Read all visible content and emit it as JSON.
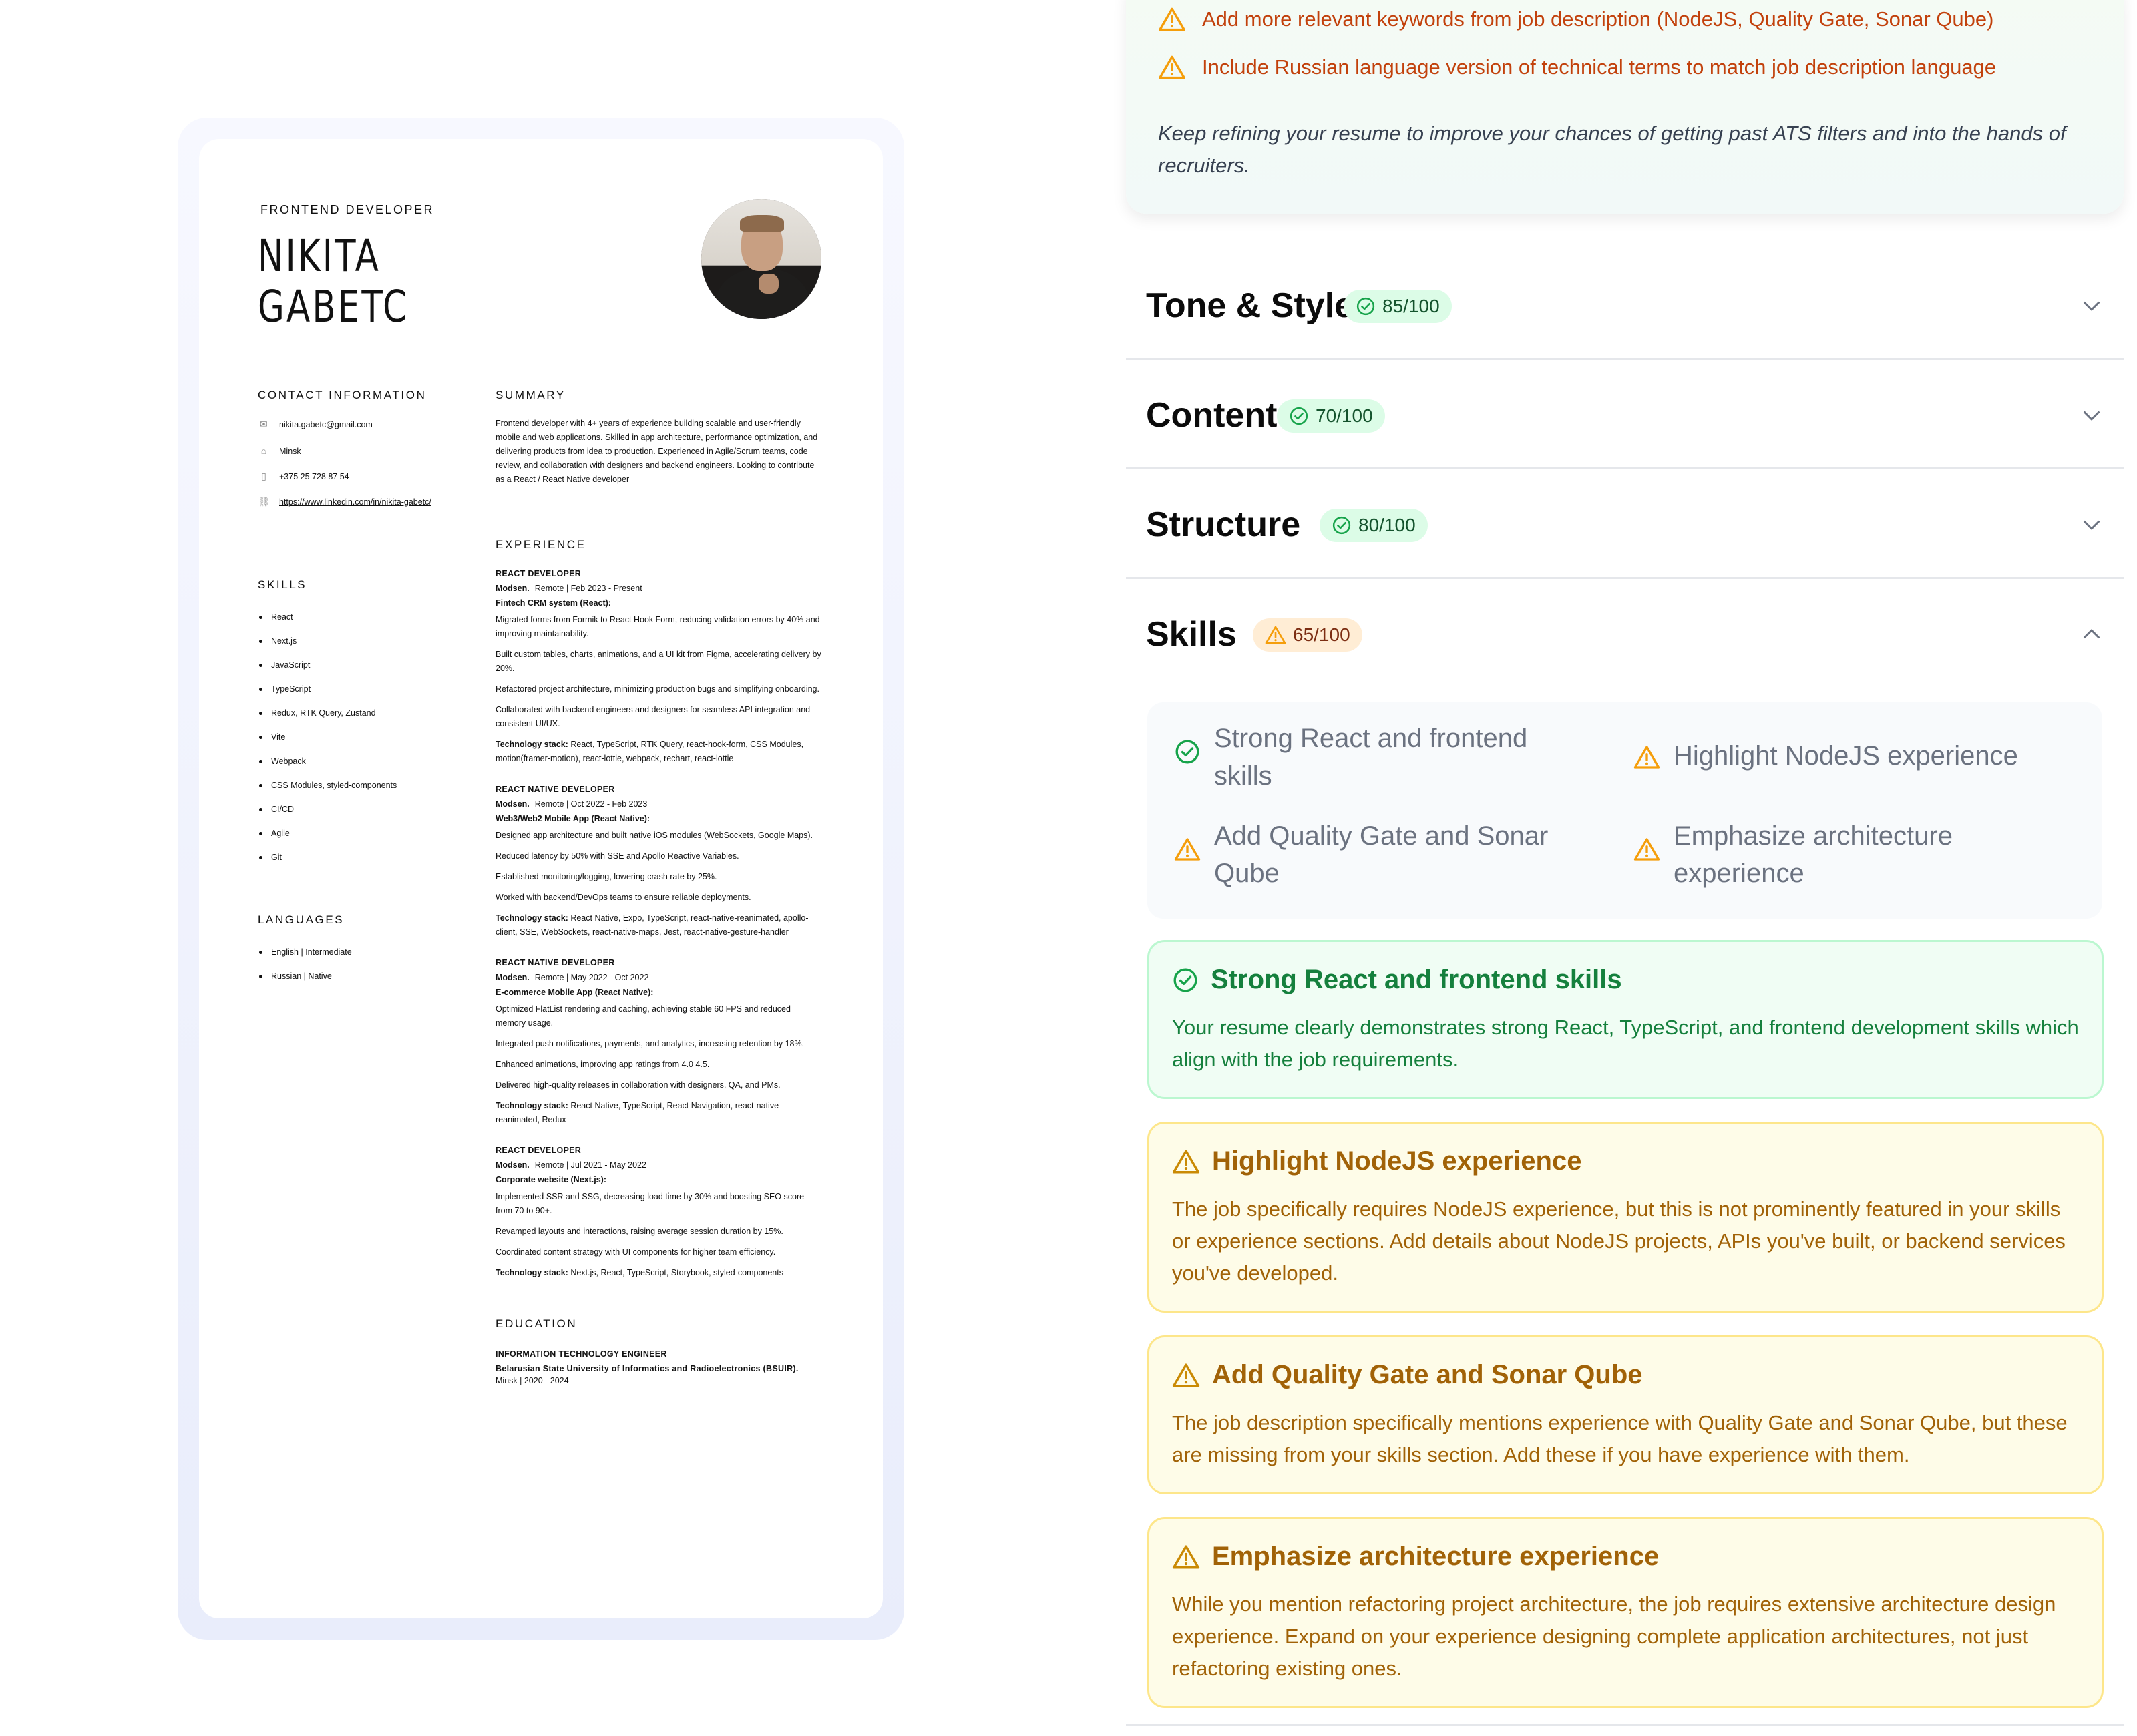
{
  "resume": {
    "role": "FRONTEND DEVELOPER",
    "name_line1": "NIKITA",
    "name_line2": "GABETC",
    "headings": {
      "contact": "CONTACT INFORMATION",
      "summary": "SUMMARY",
      "skills": "SKILLS",
      "languages": "LANGUAGES",
      "experience": "EXPERIENCE",
      "education": "EDUCATION"
    },
    "contact": {
      "email": "nikita.gabetc@gmail.com",
      "location": "Minsk",
      "phone": "+375 25 728 87 54",
      "linkedin": "https://www.linkedin.com/in/nikita-gabetc/"
    },
    "summary": "Frontend developer with 4+ years of experience building scalable and user-friendly mobile and web applications. Skilled in app architecture, performance optimization, and delivering products from idea to production. Experienced in Agile/Scrum teams, code review, and collaboration with designers and backend engineers. Looking to contribute as a React / React Native developer",
    "skills": [
      "React",
      "Next.js",
      "JavaScript",
      "TypeScript",
      "Redux, RTK Query, Zustand",
      "Vite",
      "Webpack",
      "CSS Modules, styled-components",
      "CI/CD",
      "Agile",
      "Git"
    ],
    "languages": [
      "English | Intermediate",
      "Russian | Native"
    ],
    "jobs": [
      {
        "title": "REACT DEVELOPER",
        "company": "Modsen.",
        "meta": "Remote | Feb 2023 - Present",
        "project": "Fintech CRM system (React):",
        "bullets": [
          "Migrated forms from Formik to React Hook Form, reducing validation errors by 40% and improving maintainability.",
          "Built custom tables, charts, animations, and a UI kit from Figma, accelerating delivery by 20%.",
          "Refactored project architecture, minimizing production bugs and simplifying onboarding.",
          "Collaborated with backend engineers and designers for seamless API integration and consistent UI/UX."
        ],
        "stack_label": "Technology stack:",
        "stack": "React, TypeScript, RTK Query, react-hook-form, CSS Modules, motion(framer-motion), react-lottie, webpack, rechart, react-lottie"
      },
      {
        "title": "REACT NATIVE DEVELOPER",
        "company": "Modsen.",
        "meta": "Remote | Oct 2022 - Feb 2023",
        "project": "Web3/Web2 Mobile App (React Native):",
        "bullets": [
          "Designed app architecture and built native iOS modules (WebSockets, Google Maps).",
          "Reduced latency by 50% with SSE and Apollo Reactive Variables.",
          "Established monitoring/logging, lowering crash rate by 25%.",
          "Worked with backend/DevOps teams to ensure reliable deployments."
        ],
        "stack_label": "Technology stack:",
        "stack": "React Native, Expo, TypeScript, react-native-reanimated, apollo-client, SSE, WebSockets, react-native-maps, Jest, react-native-gesture-handler"
      },
      {
        "title": "REACT NATIVE DEVELOPER",
        "company": "Modsen.",
        "meta": "Remote | May 2022 - Oct 2022",
        "project": "E-commerce Mobile App (React Native):",
        "bullets": [
          "Optimized FlatList rendering and caching, achieving stable 60 FPS and reduced memory usage.",
          "Integrated push notifications, payments, and analytics, increasing retention by 18%.",
          "Enhanced animations, improving app ratings from 4.0 4.5.",
          "Delivered high-quality releases in collaboration with designers, QA, and PMs."
        ],
        "stack_label": "Technology stack:",
        "stack": "React Native, TypeScript, React Navigation, react-native-reanimated, Redux"
      },
      {
        "title": "REACT DEVELOPER",
        "company": "Modsen.",
        "meta": "Remote | Jul 2021 - May 2022",
        "project": "Corporate website (Next.js):",
        "bullets": [
          "Implemented SSR and SSG, decreasing load time by 30% and boosting SEO score from 70 to 90+.",
          "Revamped layouts and interactions, raising average session duration by 15%.",
          "Coordinated content strategy with UI components for higher team efficiency."
        ],
        "stack_label": "Technology stack:",
        "stack": "Next.js, React, TypeScript, Storybook, styled-components"
      }
    ],
    "education": {
      "degree": "INFORMATION TECHNOLOGY ENGINEER",
      "school": "Belarusian State University of Informatics and Radioelectronics (BSUIR).",
      "meta": "Minsk | 2020 - 2024"
    }
  },
  "tips": {
    "items": [
      "Add more relevant keywords from job description (NodeJS, Quality Gate, Sonar Qube)",
      "Include Russian language version of technical terms to match job description language"
    ],
    "note": "Keep refining your resume to improve your chances of getting past ATS filters and into the hands of recruiters."
  },
  "sections": [
    {
      "title": "Tone & Style",
      "score": "85/100",
      "status": "good",
      "expanded": false
    },
    {
      "title": "Content",
      "score": "70/100",
      "status": "good",
      "expanded": false
    },
    {
      "title": "Structure",
      "score": "80/100",
      "status": "good",
      "expanded": false
    },
    {
      "title": "Skills",
      "score": "65/100",
      "status": "warn",
      "expanded": true
    }
  ],
  "skills_summary": [
    {
      "label": "Strong React and frontend skills",
      "status": "good"
    },
    {
      "label": "Highlight NodeJS experience",
      "status": "warn"
    },
    {
      "label": "Add Quality Gate and Sonar Qube",
      "status": "warn"
    },
    {
      "label": "Emphasize architecture experience",
      "status": "warn"
    }
  ],
  "feedback": [
    {
      "title": "Strong React and frontend skills",
      "status": "good",
      "body": "Your resume clearly demonstrates strong React, TypeScript, and frontend development skills which align with the job requirements."
    },
    {
      "title": "Highlight NodeJS experience",
      "status": "warn",
      "body": "The job specifically requires NodeJS experience, but this is not prominently featured in your skills or experience sections. Add details about NodeJS projects, APIs you've built, or backend services you've developed."
    },
    {
      "title": "Add Quality Gate and Sonar Qube",
      "status": "warn",
      "body": "The job description specifically mentions experience with Quality Gate and Sonar Qube, but these are missing from your skills section. Add these if you have experience with them."
    },
    {
      "title": "Emphasize architecture experience",
      "status": "warn",
      "body": "While you mention refactoring project architecture, the job requires extensive architecture design experience. Expand on your experience designing complete application architectures, not just refactoring existing ones."
    }
  ],
  "colors": {
    "good": "#16a34a",
    "warn": "#f59e0b",
    "tip_text": "#c2410c"
  },
  "icons": {
    "good": "check-circle-icon",
    "warn": "warning-triangle-icon",
    "collapsed": "chevron-down-icon",
    "expanded": "chevron-up-icon"
  }
}
